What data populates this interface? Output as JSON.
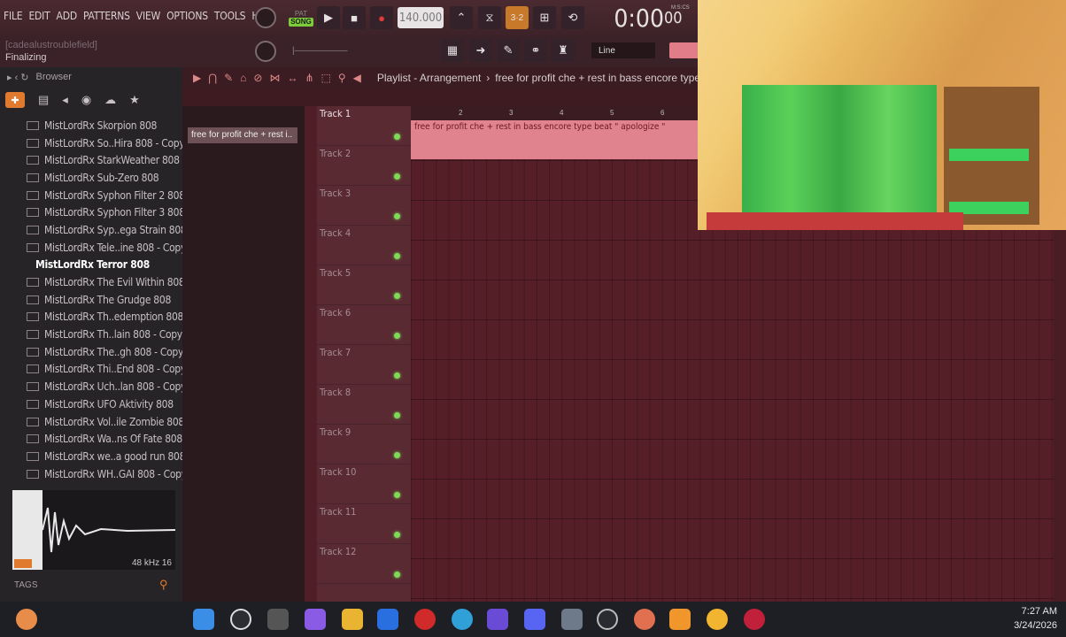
{
  "menu": [
    "FILE",
    "EDIT",
    "ADD",
    "PATTERNS",
    "VIEW",
    "OPTIONS",
    "TOOLS",
    "HELP"
  ],
  "transport": {
    "mode_pat": "PAT",
    "mode_song": "SONG",
    "tempo": "140.000",
    "time": "0:00",
    "time_frac": "00",
    "time_label": "M:S:CS"
  },
  "hint": {
    "user": "[cadealustroublefield]",
    "status": "Finalizing"
  },
  "snap": {
    "value": "Line"
  },
  "browser": {
    "title": "Browser",
    "items": [
      "MistLordRx Skorpion 808",
      "MistLordRx So..Hira 808 - Copy",
      "MistLordRx StarkWeather 808",
      "MistLordRx Sub-Zero 808",
      "MistLordRx Syphon Filter 2 808",
      "MistLordRx Syphon Filter 3 808",
      "MistLordRx Syp..ega Strain 808",
      "MistLordRx Tele..ine 808 - Copy",
      "MistLordRx Terror 808",
      "MistLordRx The Evil Within 808",
      "MistLordRx The Grudge 808",
      "MistLordRx Th..edemption 808",
      "MistLordRx Th..lain 808 - Copy",
      "MistLordRx The..gh 808 - Copy",
      "MistLordRx Thi..End 808 - Copy",
      "MistLordRx Uch..lan 808 - Copy",
      "MistLordRx UFO Aktivity 808",
      "MistLordRx Vol..ile Zombie 808",
      "MistLordRx Wa..ns Of Fate 808",
      "MistLordRx we..a good run 808",
      "MistLordRx WH..GAI 808 - Copy"
    ],
    "selected_index": 8,
    "sample_info": "48 kHz 16",
    "tags_label": "TAGS"
  },
  "playlist": {
    "title": "Playlist - Arrangement",
    "song": "free for profit che + rest in bass encore type beat",
    "clip_panel_item": "free for profit che + rest i..",
    "clip_label": "free for profit che + rest in bass encore type beat  \" apologize \"",
    "ruler": [
      "2",
      "3",
      "4",
      "5",
      "6"
    ],
    "tracks": [
      "Track 1",
      "Track 2",
      "Track 3",
      "Track 4",
      "Track 5",
      "Track 6",
      "Track 7",
      "Track 8",
      "Track 9",
      "Track 10",
      "Track 11",
      "Track 12"
    ]
  },
  "taskbar": {
    "time": "7:27 AM",
    "date": "3/24/2026"
  }
}
